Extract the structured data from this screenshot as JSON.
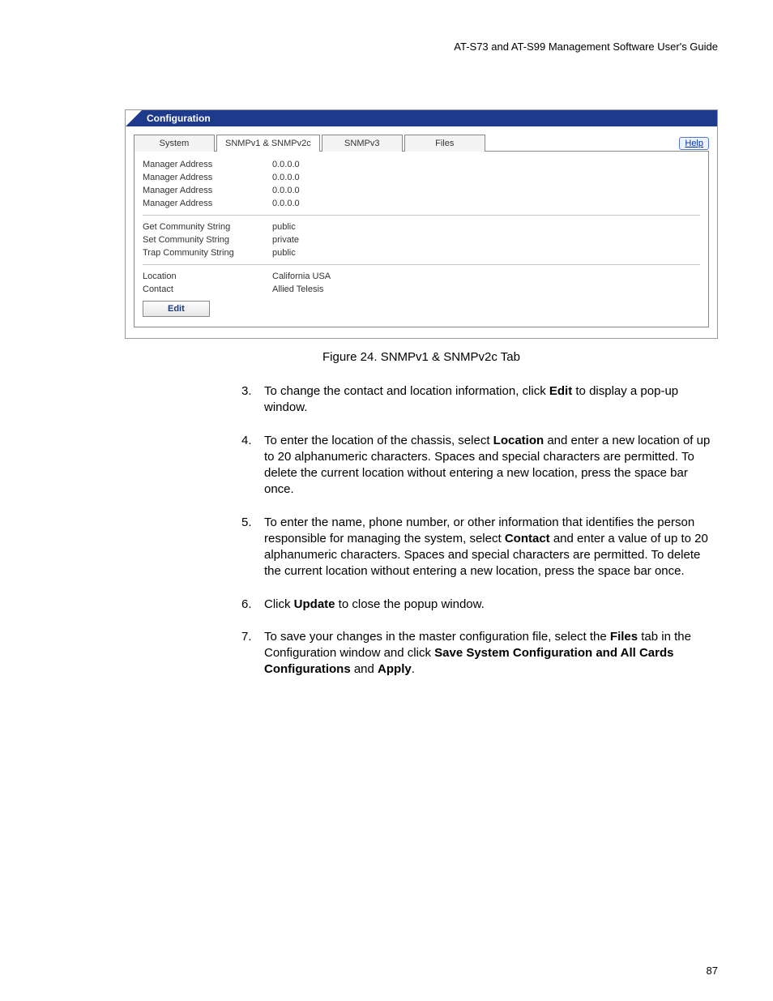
{
  "header": "AT-S73 and AT-S99 Management Software User's Guide",
  "panel": {
    "title": "Configuration",
    "tabs": [
      "System",
      "SNMPv1 & SNMPv2c",
      "SNMPv3",
      "Files"
    ],
    "active_tab_index": 1,
    "help_label": "Help",
    "managers": [
      {
        "label": "Manager Address",
        "value": "0.0.0.0"
      },
      {
        "label": "Manager Address",
        "value": "0.0.0.0"
      },
      {
        "label": "Manager Address",
        "value": "0.0.0.0"
      },
      {
        "label": "Manager Address",
        "value": "0.0.0.0"
      }
    ],
    "community": [
      {
        "label": "Get Community String",
        "value": "public"
      },
      {
        "label": "Set Community String",
        "value": "private"
      },
      {
        "label": "Trap Community String",
        "value": "public"
      }
    ],
    "info": [
      {
        "label": "Location",
        "value": "California USA"
      },
      {
        "label": "Contact",
        "value": "Allied Telesis"
      }
    ],
    "edit_label": "Edit"
  },
  "figure_caption": "Figure 24. SNMPv1 & SNMPv2c Tab",
  "steps": [
    {
      "num": "3.",
      "html": "To change the contact and location information, click <b>Edit</b> to display a pop-up window."
    },
    {
      "num": "4.",
      "html": "To enter the location of the chassis, select <b>Location</b> and enter a new location of up to 20 alphanumeric characters. Spaces and special characters are permitted. To delete the current location without entering a new location, press the space bar once."
    },
    {
      "num": "5.",
      "html": "To enter the name, phone number, or other information that identifies the person responsible for managing the system, select <b>Contact</b> and enter a value of up to 20 alphanumeric characters. Spaces and special characters are permitted. To delete the current location without entering a new location, press the space bar once."
    },
    {
      "num": "6.",
      "html": "Click <b>Update</b> to close the popup window."
    },
    {
      "num": "7.",
      "html": "To save your changes in the master configuration file, select the <b>Files</b> tab in the Configuration window and click <b>Save System Configuration and All Cards Configurations</b> and <b>Apply</b>."
    }
  ],
  "page_number": "87"
}
